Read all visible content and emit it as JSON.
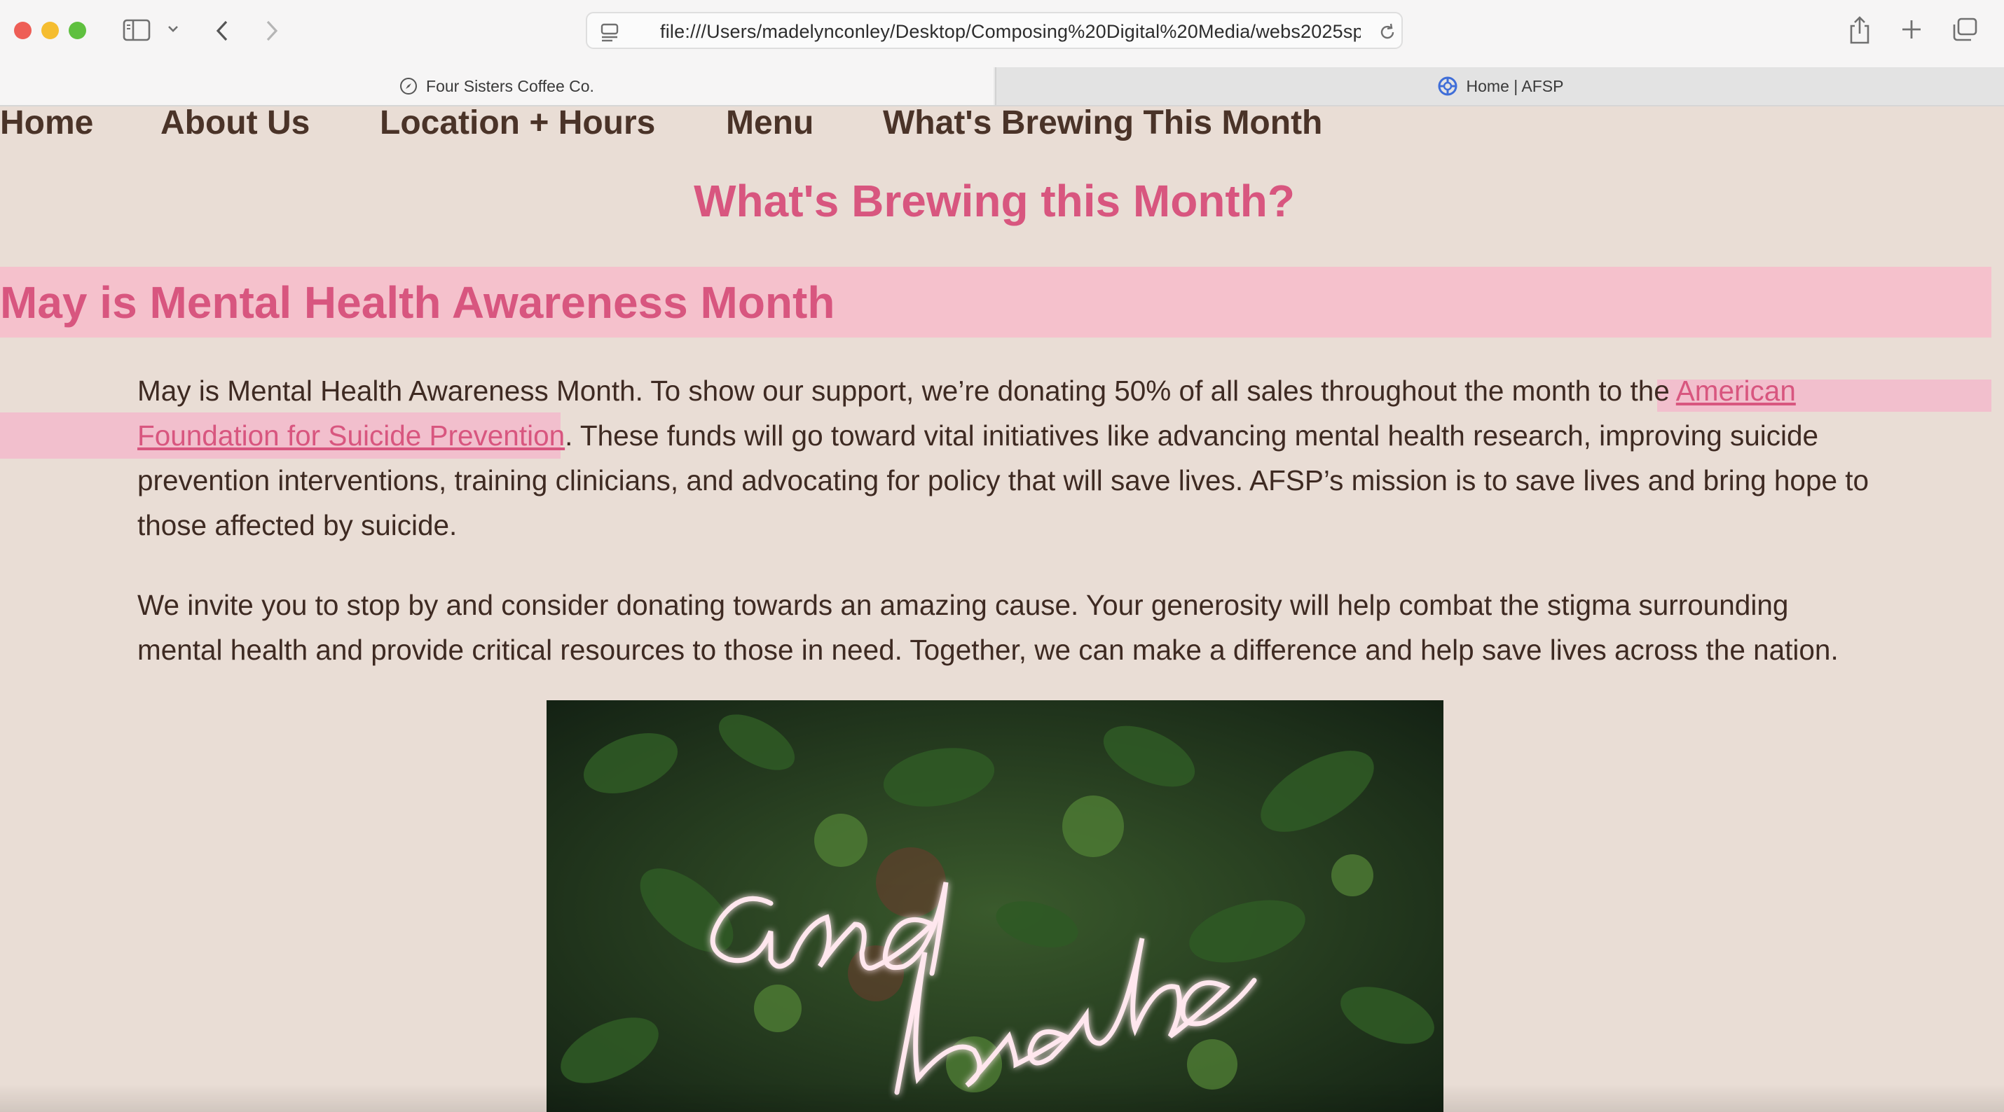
{
  "browser": {
    "url": "file:///Users/madelynconley/Desktop/Composing%20Digital%20Media/webs2025sp",
    "tabs": [
      {
        "label": "Four Sisters Coffee Co.",
        "active": true,
        "icon": "compass-icon"
      },
      {
        "label": "Home | AFSP",
        "active": false,
        "icon": "afsp-logo-icon"
      }
    ]
  },
  "nav": {
    "items": [
      "Home",
      "About Us",
      "Location + Hours",
      "Menu",
      "What's Brewing This Month"
    ]
  },
  "page": {
    "title": "What's Brewing this Month?",
    "banner": "May is Mental Health Awareness Month",
    "para1": {
      "before": "May is Mental Health Awareness Month. To show our support, we’re donating 50% of all sales throughout the month to the ",
      "link": "American Foundation for Suicide Prevention",
      "after": ". These funds will go toward vital initiatives like advancing mental health research, improving suicide prevention interventions, training clinicians, and advocating for policy that will save lives. AFSP’s mission is to save lives and bring hope to those affected by suicide."
    },
    "para2": "We invite you to stop by and consider donating towards an amazing cause. Your generosity will help combat the stigma surrounding mental health and provide critical resources to those in need. Together, we can make a difference and help save lives across the nation.",
    "image": {
      "neon_text_line1": "and",
      "neon_text_line2": "breathe"
    }
  },
  "colors": {
    "accent_pink": "#d8567f",
    "banner_pink": "#f5c1cc",
    "page_bg": "#e9ddd5",
    "nav_text": "#4a3328"
  }
}
